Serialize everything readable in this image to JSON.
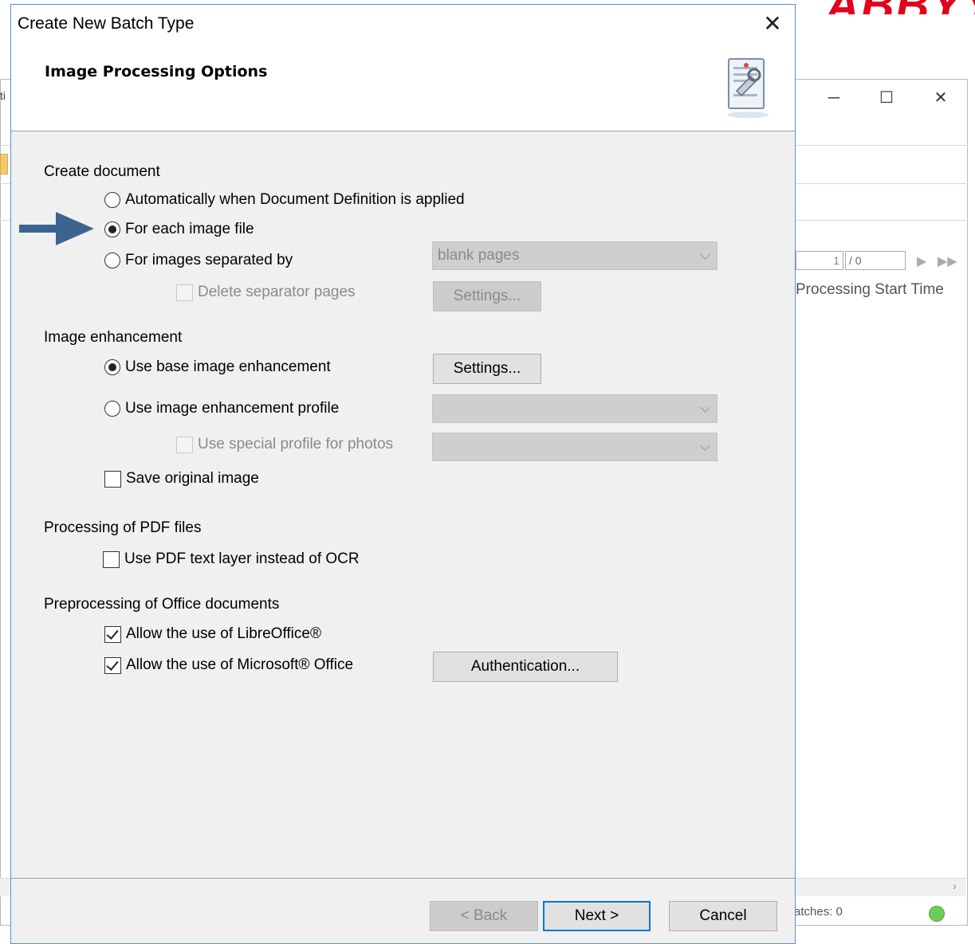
{
  "background": {
    "logo_text": "ABBYY",
    "clipped_text": "ti",
    "pager_current": "1",
    "pager_total": "/ 0",
    "column_header": "Processing Start Time",
    "status_text": "atches: 0",
    "scroll_arrow": "›"
  },
  "dialog": {
    "title": "Create New Batch Type",
    "close_glyph": "✕",
    "header_title": "Image Processing Options",
    "create_document": {
      "label": "Create document",
      "option_auto": "Automatically when Document Definition is applied",
      "option_each": "For each image file",
      "option_separated": "For images separated by",
      "separator_combo_value": "blank pages",
      "delete_separator": "Delete separator pages",
      "settings_label": "Settings..."
    },
    "image_enhancement": {
      "label": "Image enhancement",
      "option_base": "Use base image enhancement",
      "settings_label": "Settings...",
      "option_profile": "Use image enhancement profile",
      "special_profile": "Use special profile for photos",
      "save_original": "Save original image"
    },
    "pdf": {
      "label": "Processing of PDF files",
      "use_text_layer": "Use PDF text layer instead of OCR"
    },
    "office": {
      "label": "Preprocessing of Office documents",
      "allow_libre": "Allow the use of LibreOffice®",
      "allow_ms": "Allow the use of Microsoft® Office",
      "authentication_label": "Authentication..."
    },
    "footer": {
      "back_label": "< Back",
      "next_label": "Next >",
      "cancel_label": "Cancel"
    }
  },
  "colors": {
    "dialog_border": "#5b8fd1",
    "annotation_arrow": "#3d6491",
    "default_button_border": "#0078d7",
    "status_ok": "#6ccc55",
    "logo": "#e3001b"
  }
}
